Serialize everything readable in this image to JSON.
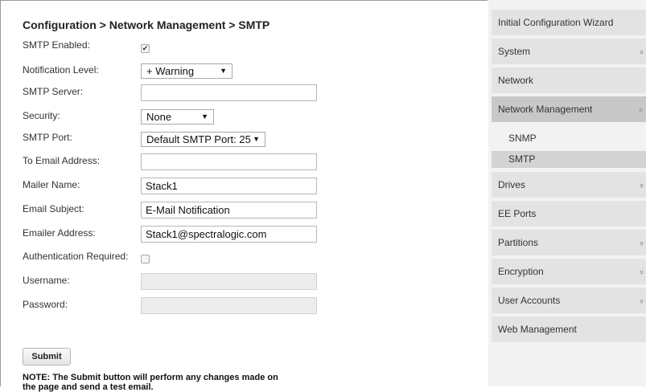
{
  "title": "Configuration > Network Management > SMTP",
  "form": {
    "smtp_enabled_label": "SMTP Enabled:",
    "smtp_enabled_checked": true,
    "notification_level_label": "Notification Level:",
    "notification_level_value": "+ Warning",
    "smtp_server_label": "SMTP Server:",
    "smtp_server_value": "",
    "security_label": "Security:",
    "security_value": "None",
    "smtp_port_label": "SMTP Port:",
    "smtp_port_value": "Default SMTP Port: 25",
    "to_email_label": "To Email Address:",
    "to_email_value": "",
    "mailer_name_label": "Mailer Name:",
    "mailer_name_value": "Stack1",
    "email_subject_label": "Email Subject:",
    "email_subject_value": "E-Mail Notification",
    "emailer_address_label": "Emailer Address:",
    "emailer_address_value": "Stack1@spectralogic.com",
    "auth_required_label": "Authentication Required:",
    "auth_required_checked": false,
    "username_label": "Username:",
    "username_value": "",
    "password_label": "Password:",
    "password_value": "",
    "submit_label": "Submit",
    "note": "NOTE: The Submit button will perform any changes made on the page and send a test email."
  },
  "sidebar": {
    "items": [
      {
        "label": "Initial Configuration Wizard"
      },
      {
        "label": "System",
        "icon": "chevron-down-icon"
      },
      {
        "label": "Network"
      },
      {
        "label": "Network Management",
        "icon": "chevron-up-icon",
        "active": true
      },
      {
        "label": "Drives",
        "icon": "chevron-down-icon"
      },
      {
        "label": "EE Ports"
      },
      {
        "label": "Partitions",
        "icon": "chevron-down-icon"
      },
      {
        "label": "Encryption",
        "icon": "chevron-down-icon"
      },
      {
        "label": "User Accounts",
        "icon": "chevron-down-icon"
      },
      {
        "label": "Web Management"
      }
    ],
    "subitems": [
      {
        "label": "SNMP"
      },
      {
        "label": "SMTP",
        "selected": true
      }
    ]
  }
}
